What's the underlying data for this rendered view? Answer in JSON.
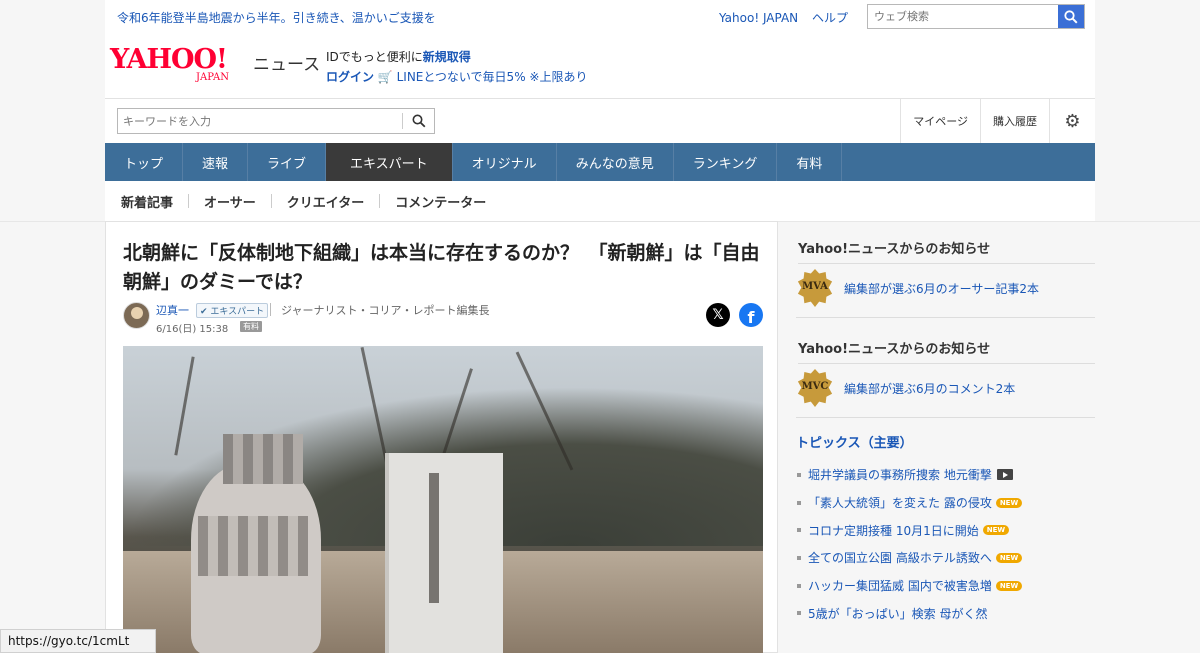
{
  "topbar": {
    "notice": "令和6年能登半島地震から半年。引き続き、温かいご支援を",
    "links": [
      "Yahoo! JAPAN",
      "ヘルプ"
    ],
    "search_placeholder": "ウェブ検索"
  },
  "header": {
    "logo_yahoo": "YAHOO!",
    "logo_japan": "JAPAN",
    "logo_news": "ニュース",
    "promo_text": "IDでもっと便利に",
    "register": "新規取得",
    "login": "ログイン",
    "line_promo": "LINEとつないで毎日5% ※上限あり"
  },
  "search": {
    "placeholder": "キーワードを入力"
  },
  "account_links": [
    "マイページ",
    "購入履歴"
  ],
  "nav": {
    "tabs": [
      "トップ",
      "速報",
      "ライブ",
      "エキスパート",
      "オリジナル",
      "みんなの意見",
      "ランキング",
      "有料"
    ],
    "active": "エキスパート"
  },
  "subnav": [
    "新着記事",
    "オーサー",
    "クリエイター",
    "コメンテーター"
  ],
  "article": {
    "title": "北朝鮮に「反体制地下組織」は本当に存在するのか？　「新朝鮮」は「自由朝鮮」のダミーでは？",
    "author": "辺真一",
    "expert_badge": "エキスパート",
    "role": "ジャーナリスト・コリア・レポート編集長",
    "date": "6/16(日) 15:38",
    "paid_label": "有料",
    "share_x": "𝕏",
    "share_fb": "f"
  },
  "sidebar": {
    "notices": [
      {
        "heading": "Yahoo!ニュースからのお知らせ",
        "medal": "MVA",
        "text": "編集部が選ぶ6月のオーサー記事2本"
      },
      {
        "heading": "Yahoo!ニュースからのお知らせ",
        "medal": "MVC",
        "text": "編集部が選ぶ6月のコメント2本"
      }
    ],
    "topics_heading": "トピックス（主要）",
    "topics": [
      {
        "text": "堀井学議員の事務所捜索 地元衝撃",
        "video": true,
        "new": false
      },
      {
        "text": "「素人大統領」を変えた 露の侵攻",
        "video": false,
        "new": true
      },
      {
        "text": "コロナ定期接種 10月1日に開始",
        "video": false,
        "new": true
      },
      {
        "text": "全ての国立公園 高級ホテル誘致へ",
        "video": false,
        "new": true
      },
      {
        "text": "ハッカー集団猛威 国内で被害急増",
        "video": false,
        "new": true
      },
      {
        "text": "5歳が「おっぱい」検索 母がく然",
        "video": false,
        "new": false
      }
    ],
    "new_label": "NEW"
  },
  "statusbar": "https://gyo.tc/1cmLt"
}
